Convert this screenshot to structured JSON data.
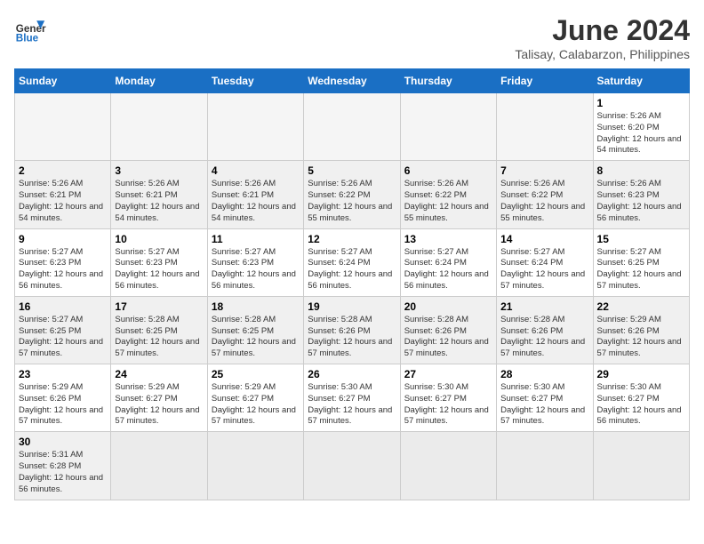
{
  "header": {
    "logo_general": "General",
    "logo_blue": "Blue",
    "month_title": "June 2024",
    "location": "Talisay, Calabarzon, Philippines"
  },
  "weekdays": [
    "Sunday",
    "Monday",
    "Tuesday",
    "Wednesday",
    "Thursday",
    "Friday",
    "Saturday"
  ],
  "rows": [
    {
      "shaded": false,
      "cells": [
        {
          "day": "",
          "empty": true
        },
        {
          "day": "",
          "empty": true
        },
        {
          "day": "",
          "empty": true
        },
        {
          "day": "",
          "empty": true
        },
        {
          "day": "",
          "empty": true
        },
        {
          "day": "",
          "empty": true
        },
        {
          "day": "1",
          "sunrise": "5:26 AM",
          "sunset": "6:20 PM",
          "daylight": "12 hours and 54 minutes."
        }
      ]
    },
    {
      "shaded": true,
      "cells": [
        {
          "day": "2",
          "sunrise": "5:26 AM",
          "sunset": "6:21 PM",
          "daylight": "12 hours and 54 minutes."
        },
        {
          "day": "3",
          "sunrise": "5:26 AM",
          "sunset": "6:21 PM",
          "daylight": "12 hours and 54 minutes."
        },
        {
          "day": "4",
          "sunrise": "5:26 AM",
          "sunset": "6:21 PM",
          "daylight": "12 hours and 54 minutes."
        },
        {
          "day": "5",
          "sunrise": "5:26 AM",
          "sunset": "6:22 PM",
          "daylight": "12 hours and 55 minutes."
        },
        {
          "day": "6",
          "sunrise": "5:26 AM",
          "sunset": "6:22 PM",
          "daylight": "12 hours and 55 minutes."
        },
        {
          "day": "7",
          "sunrise": "5:26 AM",
          "sunset": "6:22 PM",
          "daylight": "12 hours and 55 minutes."
        },
        {
          "day": "8",
          "sunrise": "5:26 AM",
          "sunset": "6:23 PM",
          "daylight": "12 hours and 56 minutes."
        }
      ]
    },
    {
      "shaded": false,
      "cells": [
        {
          "day": "9",
          "sunrise": "5:27 AM",
          "sunset": "6:23 PM",
          "daylight": "12 hours and 56 minutes."
        },
        {
          "day": "10",
          "sunrise": "5:27 AM",
          "sunset": "6:23 PM",
          "daylight": "12 hours and 56 minutes."
        },
        {
          "day": "11",
          "sunrise": "5:27 AM",
          "sunset": "6:23 PM",
          "daylight": "12 hours and 56 minutes."
        },
        {
          "day": "12",
          "sunrise": "5:27 AM",
          "sunset": "6:24 PM",
          "daylight": "12 hours and 56 minutes."
        },
        {
          "day": "13",
          "sunrise": "5:27 AM",
          "sunset": "6:24 PM",
          "daylight": "12 hours and 56 minutes."
        },
        {
          "day": "14",
          "sunrise": "5:27 AM",
          "sunset": "6:24 PM",
          "daylight": "12 hours and 57 minutes."
        },
        {
          "day": "15",
          "sunrise": "5:27 AM",
          "sunset": "6:25 PM",
          "daylight": "12 hours and 57 minutes."
        }
      ]
    },
    {
      "shaded": true,
      "cells": [
        {
          "day": "16",
          "sunrise": "5:27 AM",
          "sunset": "6:25 PM",
          "daylight": "12 hours and 57 minutes."
        },
        {
          "day": "17",
          "sunrise": "5:28 AM",
          "sunset": "6:25 PM",
          "daylight": "12 hours and 57 minutes."
        },
        {
          "day": "18",
          "sunrise": "5:28 AM",
          "sunset": "6:25 PM",
          "daylight": "12 hours and 57 minutes."
        },
        {
          "day": "19",
          "sunrise": "5:28 AM",
          "sunset": "6:26 PM",
          "daylight": "12 hours and 57 minutes."
        },
        {
          "day": "20",
          "sunrise": "5:28 AM",
          "sunset": "6:26 PM",
          "daylight": "12 hours and 57 minutes."
        },
        {
          "day": "21",
          "sunrise": "5:28 AM",
          "sunset": "6:26 PM",
          "daylight": "12 hours and 57 minutes."
        },
        {
          "day": "22",
          "sunrise": "5:29 AM",
          "sunset": "6:26 PM",
          "daylight": "12 hours and 57 minutes."
        }
      ]
    },
    {
      "shaded": false,
      "cells": [
        {
          "day": "23",
          "sunrise": "5:29 AM",
          "sunset": "6:26 PM",
          "daylight": "12 hours and 57 minutes."
        },
        {
          "day": "24",
          "sunrise": "5:29 AM",
          "sunset": "6:27 PM",
          "daylight": "12 hours and 57 minutes."
        },
        {
          "day": "25",
          "sunrise": "5:29 AM",
          "sunset": "6:27 PM",
          "daylight": "12 hours and 57 minutes."
        },
        {
          "day": "26",
          "sunrise": "5:30 AM",
          "sunset": "6:27 PM",
          "daylight": "12 hours and 57 minutes."
        },
        {
          "day": "27",
          "sunrise": "5:30 AM",
          "sunset": "6:27 PM",
          "daylight": "12 hours and 57 minutes."
        },
        {
          "day": "28",
          "sunrise": "5:30 AM",
          "sunset": "6:27 PM",
          "daylight": "12 hours and 57 minutes."
        },
        {
          "day": "29",
          "sunrise": "5:30 AM",
          "sunset": "6:27 PM",
          "daylight": "12 hours and 56 minutes."
        }
      ]
    },
    {
      "shaded": true,
      "cells": [
        {
          "day": "30",
          "sunrise": "5:31 AM",
          "sunset": "6:28 PM",
          "daylight": "12 hours and 56 minutes."
        },
        {
          "day": "",
          "empty": true
        },
        {
          "day": "",
          "empty": true
        },
        {
          "day": "",
          "empty": true
        },
        {
          "day": "",
          "empty": true
        },
        {
          "day": "",
          "empty": true
        },
        {
          "day": "",
          "empty": true
        }
      ]
    }
  ]
}
